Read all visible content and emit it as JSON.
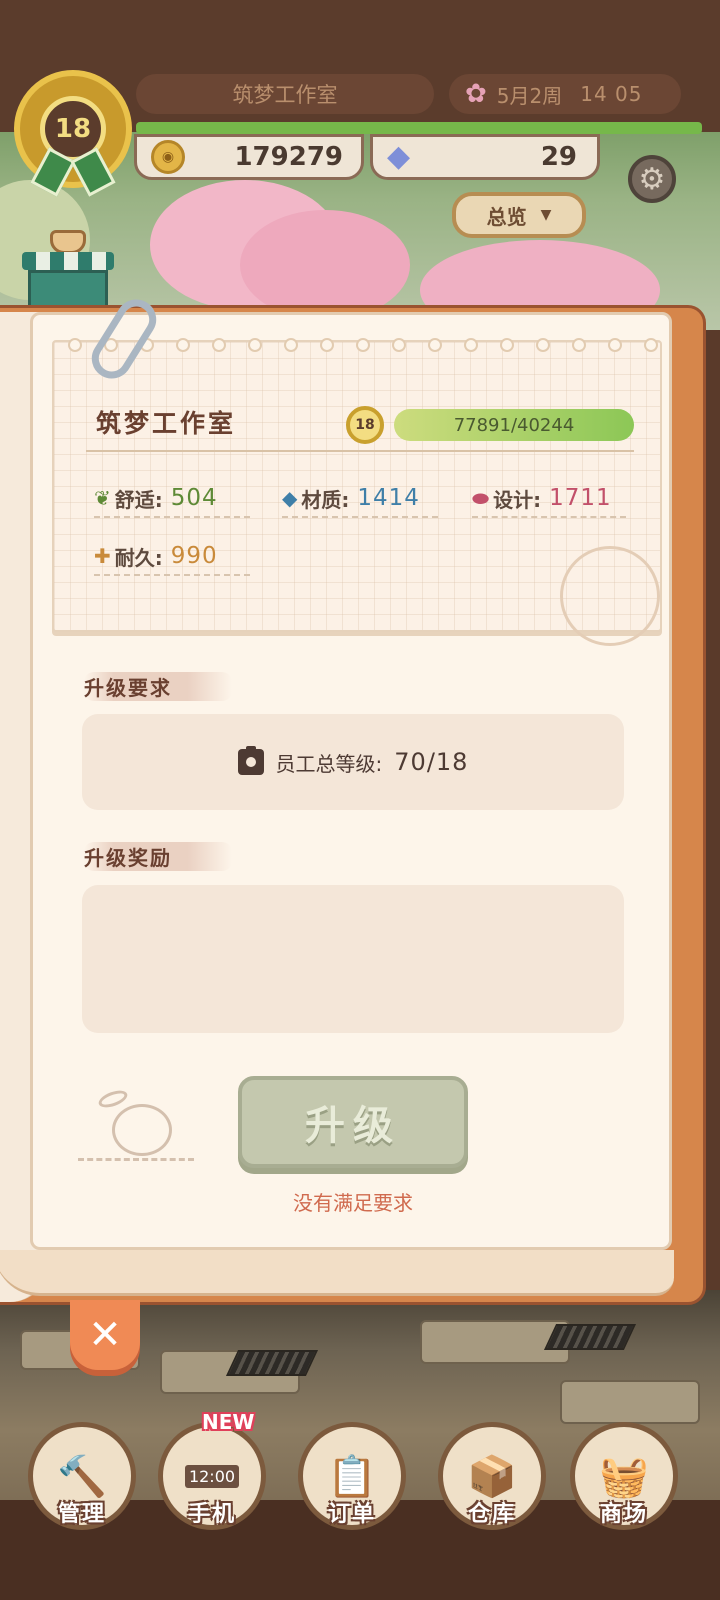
{
  "header": {
    "level": "18",
    "studio_name": "筑梦工作室",
    "date": "5月2周",
    "time": "14 05",
    "coins": "179279",
    "gems": "29",
    "overview_label": "总览"
  },
  "panel": {
    "title": "筑梦工作室",
    "level": "18",
    "xp_text": "77891/40244",
    "stats": {
      "comfort_label": "舒适:",
      "comfort_value": "504",
      "material_label": "材质:",
      "material_value": "1414",
      "design_label": "设计:",
      "design_value": "1711",
      "durability_label": "耐久:",
      "durability_value": "990"
    },
    "requirement_title": "升级要求",
    "requirement_label": "员工总等级:",
    "requirement_value": "70/18",
    "reward_title": "升级奖励",
    "upgrade_label": "升级",
    "unmet_text": "没有满足要求"
  },
  "nav": {
    "items": [
      {
        "label": "管理",
        "icon": "hammer-icon"
      },
      {
        "label": "手机",
        "icon": "phone-icon",
        "badge": "NEW",
        "clock": "12:00"
      },
      {
        "label": "订单",
        "icon": "clipboard-icon"
      },
      {
        "label": "仓库",
        "icon": "box-icon"
      },
      {
        "label": "商场",
        "icon": "basket-icon"
      }
    ]
  },
  "colors": {
    "panel_bg": "#fdf5ea",
    "accent_orange": "#f08a55",
    "comfort": "#5e8a36",
    "material": "#3f7fa8",
    "design": "#c2506a",
    "durability": "#c98a3a",
    "disabled_button": "#c4c8ae"
  }
}
